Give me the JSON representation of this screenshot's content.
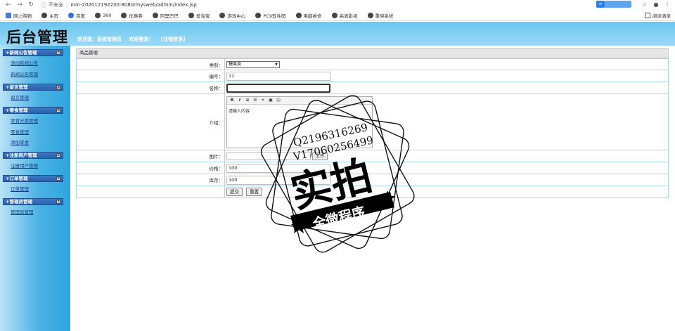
{
  "browser": {
    "insecure_label": "不安全",
    "url": "mm-202012192230:8080/mysweb/admin/index.jsp",
    "bookmarks": [
      "网上购物",
      "主页",
      "百度",
      "360",
      "优惠券",
      "阿里巴巴",
      "爱淘宝",
      "游戏中心",
      "PC9软件园",
      "电脑维修",
      "高清影视",
      "重映系统"
    ],
    "reading_list": "阅读清单"
  },
  "header": {
    "logo": "后台管理",
    "welcome_user": "欢迎您：系统管理员",
    "welcome_msg": "欢迎登录！",
    "logout": "[注销登录]"
  },
  "sidebar": {
    "groups": [
      {
        "title": "+新闻公告管理",
        "items": [
          "添加新闻公告",
          "新闻公告管理"
        ]
      },
      {
        "title": "+留言管理",
        "items": [
          "留言管理"
        ]
      },
      {
        "title": "+零食管理",
        "items": [
          "零食分类管理",
          "零食管理",
          "添加零食"
        ]
      },
      {
        "title": "+注册用户管理",
        "items": [
          "注册用户管理"
        ]
      },
      {
        "title": "+订单管理",
        "items": [
          "订单管理"
        ]
      },
      {
        "title": "+管理员管理",
        "items": [
          "管理员管理"
        ]
      }
    ],
    "expand_symbol": "±"
  },
  "panel": {
    "title": "商品管理",
    "fields": {
      "category_label": "类别：",
      "category_value": "糖果类",
      "number_label": "编号：",
      "number_value": "11",
      "name_label": "名称：",
      "name_value": "",
      "intro_label": "介绍：",
      "intro_placeholder": "请输入内容",
      "image_label": "图片：",
      "image_button": "上传",
      "price_label": "价格：",
      "price_value": "100",
      "stock_label": "库存：",
      "stock_value": "100"
    },
    "submit": "提交",
    "reset": "重置"
  },
  "watermark": {
    "line1": "Q2196316269",
    "line2": "V17060256499",
    "big": "实拍",
    "banner": "全微程序"
  }
}
